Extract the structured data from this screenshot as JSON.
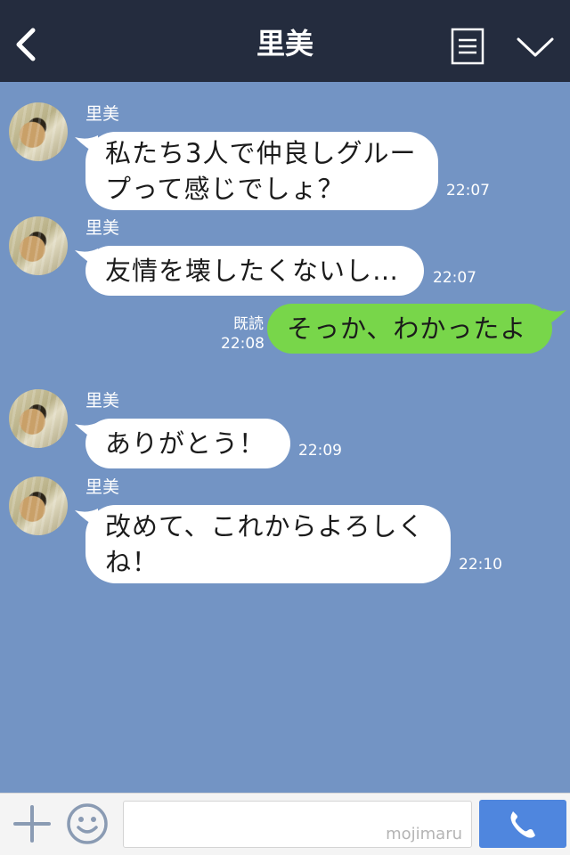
{
  "header": {
    "title": "里美",
    "back_icon": "chevron-left-icon",
    "menu_icon": "note-list-icon",
    "collapse_icon": "chevron-down-icon",
    "background": "#242c3e"
  },
  "chat": {
    "background": "#7394c4",
    "incoming_bubble_color": "#ffffff",
    "outgoing_bubble_color": "#78d64a",
    "messages": [
      {
        "direction": "in",
        "sender": "里美",
        "lines": [
          "私たち3人で仲良しグルー",
          "プって感じでしょ？"
        ],
        "time": "22:07"
      },
      {
        "direction": "in",
        "sender": "里美",
        "lines": [
          "友情を壊したくないし…"
        ],
        "time": "22:07"
      },
      {
        "direction": "out",
        "lines": [
          "そっか、わかったよ"
        ],
        "read_label": "既読",
        "time": "22:08"
      },
      {
        "direction": "in",
        "sender": "里美",
        "lines": [
          "ありがとう！"
        ],
        "time": "22:09"
      },
      {
        "direction": "in",
        "sender": "里美",
        "lines": [
          "改めて、これからよろしく",
          "ね！"
        ],
        "time": "22:10"
      }
    ]
  },
  "footer": {
    "plus_icon": "plus-icon",
    "emoji_icon": "smiley-icon",
    "input_value": "",
    "watermark": "mojimaru",
    "call_icon": "phone-icon",
    "call_button_color": "#4f86de"
  }
}
